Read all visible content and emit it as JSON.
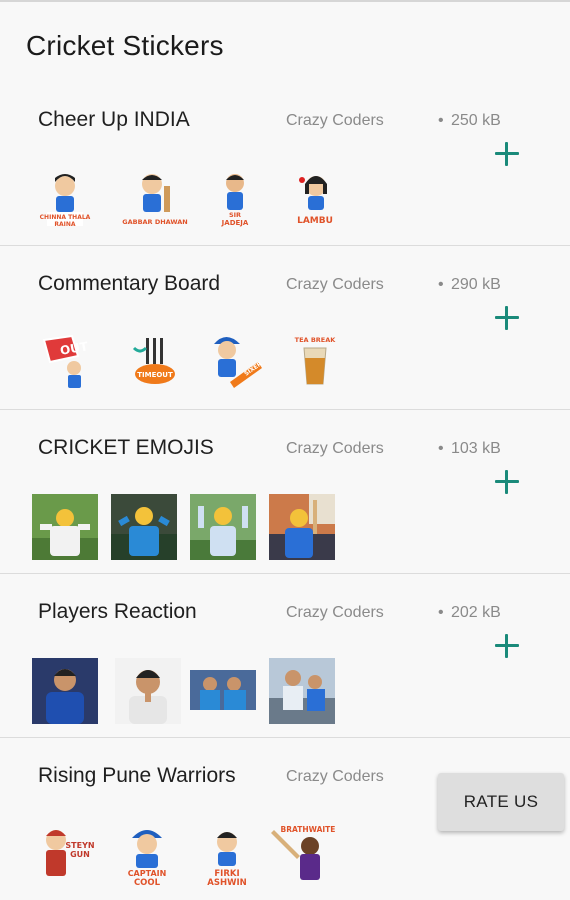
{
  "app": {
    "title": "Cricket Stickers"
  },
  "packs": [
    {
      "name": "Cheer Up INDIA",
      "publisher": "Crazy Coders",
      "size": "250 kB",
      "stickers": [
        {
          "icon": "sticker-cartoon-player",
          "caption": "CHINNA THALA RAINA"
        },
        {
          "icon": "sticker-cartoon-player",
          "caption": "GABBAR DHAWAN"
        },
        {
          "icon": "sticker-cartoon-player",
          "caption": "SIR JADEJA"
        },
        {
          "icon": "sticker-cartoon-player",
          "caption": "LAMBU"
        }
      ]
    },
    {
      "name": "Commentary Board",
      "publisher": "Crazy Coders",
      "size": "290 kB",
      "stickers": [
        {
          "icon": "sticker-out-sign",
          "caption": "OUT"
        },
        {
          "icon": "sticker-wicket",
          "caption": "TIMEOUT"
        },
        {
          "icon": "sticker-cartoon-player",
          "caption": ""
        },
        {
          "icon": "sticker-tea-glass",
          "caption": "TEA BREAK"
        }
      ]
    },
    {
      "name": "CRICKET EMOJIS",
      "publisher": "Crazy Coders",
      "size": "103 kB",
      "stickers": [
        {
          "icon": "sticker-photo-umpire"
        },
        {
          "icon": "sticker-photo-player"
        },
        {
          "icon": "sticker-photo-player"
        },
        {
          "icon": "sticker-photo-player"
        }
      ]
    },
    {
      "name": "Players Reaction",
      "publisher": "Crazy Coders",
      "size": "202 kB",
      "stickers": [
        {
          "icon": "sticker-photo-player"
        },
        {
          "icon": "sticker-photo-player"
        },
        {
          "icon": "sticker-photo-player"
        },
        {
          "icon": "sticker-photo-player"
        }
      ]
    },
    {
      "name": "Rising Pune Warriors",
      "publisher": "Crazy Coders",
      "size": "",
      "stickers": [
        {
          "icon": "sticker-cartoon-player",
          "caption": "STEYN GUN"
        },
        {
          "icon": "sticker-cartoon-player",
          "caption": "CAPTAIN COOL"
        },
        {
          "icon": "sticker-cartoon-player",
          "caption": "FIRKI ASHWIN"
        },
        {
          "icon": "sticker-cartoon-player",
          "caption": "BRATHWAITE"
        }
      ]
    }
  ],
  "rate_button": {
    "label": "RATE US"
  },
  "colors": {
    "accent": "#1a8a7a",
    "divider": "#dcdcdc",
    "background": "#f8f8f8"
  }
}
